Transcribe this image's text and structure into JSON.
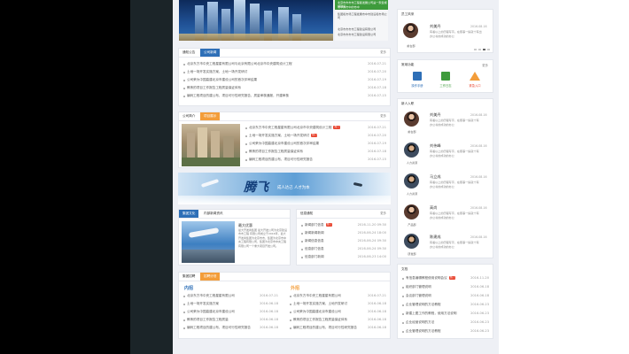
{
  "banner": {
    "text_lines": [
      "北京市市市市工程星发展公司是一家集规划建设",
      "市中的市中的市中",
      "集团和市场工程发展市中市建设和市场公司"
    ],
    "caption_lines": [
      "北京市市市市工程建设有限公司",
      "北京市市市市工程建设有限公司"
    ]
  },
  "notice": {
    "tabs": [
      {
        "label": "通知公告"
      },
      {
        "label": "公司新闻"
      }
    ],
    "more": "更多",
    "items": [
      {
        "title": "北京东方市中央工程星星有限公司与北京有限公司北京市中央建筑设计工程",
        "date": "2016-07-21"
      },
      {
        "title": "土地一场开发实施方案，土地一场开发研讨",
        "date": "2016-07-20"
      },
      {
        "title": "公司荣为中国高建北京市建设公司的首次评审结果",
        "date": "2016-07-19"
      },
      {
        "title": "教练的项目工作报告工程质量保证体系",
        "date": "2016-07-18"
      },
      {
        "title": "编码工程项目的建公布，项目可行性研究报告，质量审核通报，开建审核",
        "date": "2016-07-15"
      }
    ]
  },
  "project": {
    "tabs": [
      {
        "label": "公司简介"
      },
      {
        "label": "项目展示"
      }
    ],
    "more": "更多",
    "items": [
      {
        "title": "北京东方市中央工程星星有限公司北京市中央建筑设计工程",
        "date": "2016-07-21",
        "hot": "热门"
      },
      {
        "title": "土地一场开发实施方案，土地一场开发研讨",
        "date": "2016-07-20",
        "hot": "热门"
      },
      {
        "title": "公司荣为中国高建北京市建设公司的首次评审结果",
        "date": "2016-07-19",
        "hot": ""
      },
      {
        "title": "教练的项目工作报告工程质量保证体系",
        "date": "2016-07-18",
        "hot": ""
      },
      {
        "title": "编码工程项目的建公布，项目可行性研究报告",
        "date": "2016-07-15",
        "hot": ""
      }
    ]
  },
  "wide_banner": {
    "slogan": "腾飞",
    "tagline": "成人达己 人才为本"
  },
  "culture": {
    "tabs": [
      {
        "label": "集团文化"
      },
      {
        "label": "内部新闻资讯"
      }
    ],
    "title": "最大优惠",
    "desc": "最大开发商集团 最大开发公司为北京建设市市工程 有限公司成立于2016年，最大开发商集团为北京市市，集团为北京市中央工程有限公司，集团为北京市中央工程有限公司一个重大项目开发公司。"
  },
  "notice2": {
    "tabs": [
      {
        "label": "信息通知"
      }
    ],
    "more": "更多",
    "items": [
      {
        "title": "新闻部门信息",
        "date": "2016-11-20 09:30",
        "hot": "热门"
      },
      {
        "title": "新闻新闻新闻",
        "date": "2016-06-24 18:00",
        "hot": ""
      },
      {
        "title": "新闻信息信息",
        "date": "2016-06-24 09:30",
        "hot": ""
      },
      {
        "title": "信息部门信息",
        "date": "2016-06-24 09:30",
        "hot": ""
      },
      {
        "title": "信息部门新闻",
        "date": "2016-06-23 14:00",
        "hot": ""
      }
    ]
  },
  "recruit": {
    "tabs": [
      {
        "label": "集团招聘"
      },
      {
        "label": "招聘计划"
      }
    ],
    "col1": {
      "title": "内招",
      "items": [
        {
          "title": "北京东方市中央工程星星有限公司",
          "date": "2016-07-21"
        },
        {
          "title": "土地一场开发实施方案",
          "date": "2016-06-18"
        },
        {
          "title": "公司荣为中国高建北京市建设公司",
          "date": "2016-06-18"
        },
        {
          "title": "教练的项目工作报告工程质量",
          "date": "2016-06-18"
        },
        {
          "title": "编码工程项目的建公布，项目可行性研究报告",
          "date": "2016-06-18"
        }
      ]
    },
    "col2": {
      "title": "外招",
      "items": [
        {
          "title": "北京东方市中央工程星星有限公司",
          "date": "2016-07-21"
        },
        {
          "title": "土地一场开发实施方案，土地开发研讨",
          "date": "2016-06-18"
        },
        {
          "title": "公司荣为中国高建北京市建设公司",
          "date": "2016-06-18"
        },
        {
          "title": "教练的项目工作报告工程质量保证体系",
          "date": "2016-06-18"
        },
        {
          "title": "编码工程项目的建公布，项目可行性研究报告",
          "date": "2016-06-18"
        }
      ]
    }
  },
  "employee_star": {
    "title": "员工风采",
    "name": "刘美丹",
    "date": "2016-08-16",
    "desc_lines": [
      "有着以上的历程写字。在照事一提就十有出",
      "办公书的成功的办公"
    ],
    "role": "前台部"
  },
  "quick": {
    "title": "常用功能",
    "more": "更多",
    "items": [
      {
        "label": "操作手册"
      },
      {
        "label": "工作日志"
      },
      {
        "label": "紧急入口"
      }
    ]
  },
  "new_staff": {
    "title": "新人入职",
    "people": [
      {
        "name": "刘美丹",
        "date": "2016-08-16",
        "role": "前台部",
        "desc_lines": [
          "有着以上的历程写字，在照事一提就十有",
          "办公书的成功的办公"
        ]
      },
      {
        "name": "刘伟峰",
        "date": "2016-08-16",
        "role": "人力资源",
        "desc_lines": [
          "有着以上的历程写字，在照事一提就十有",
          "办公书的成功的办公"
        ]
      },
      {
        "name": "马立成",
        "date": "2016-08-16",
        "role": "人力资源",
        "desc_lines": [
          "有着以上的历程写字，在照事一提就十有",
          "办公书的成功的办公"
        ]
      },
      {
        "name": "高尚",
        "date": "2016-08-16",
        "role": "产品部",
        "desc_lines": [
          "有着以上的历程写字，在照事一提就十有",
          "办公书的成功的办公"
        ]
      },
      {
        "name": "陈建成",
        "date": "2016-08-16",
        "role": "研发部",
        "desc_lines": [
          "有着以上的历程写字，在照事一提就十有",
          "办公书的成功的办公"
        ]
      }
    ]
  },
  "docs": {
    "title": "文档",
    "items": [
      {
        "title": "有信息编辑教程使用说明会议",
        "date": "2016-11-20",
        "hot": "热门"
      },
      {
        "title": "组织部门管理说明",
        "date": "2016-06-18",
        "hot": ""
      },
      {
        "title": "会议部门管理说明",
        "date": "2016-06-18",
        "hot": ""
      },
      {
        "title": "企业管理说明的方法教程",
        "date": "2016-06-23",
        "hot": ""
      },
      {
        "title": "新建上图工作的教程，使用方法说明",
        "date": "2016-06-23",
        "hot": ""
      },
      {
        "title": "企业经营说明的方法",
        "date": "2016-06-23",
        "hot": ""
      },
      {
        "title": "企业管理说明的方法教程",
        "date": "2016-06-23",
        "hot": ""
      }
    ]
  },
  "colors": {
    "accent_blue": "#2e6fb7",
    "accent_orange": "#f39d3a",
    "hot_red": "#e8432e",
    "banner_green": "#3e9b3c"
  }
}
